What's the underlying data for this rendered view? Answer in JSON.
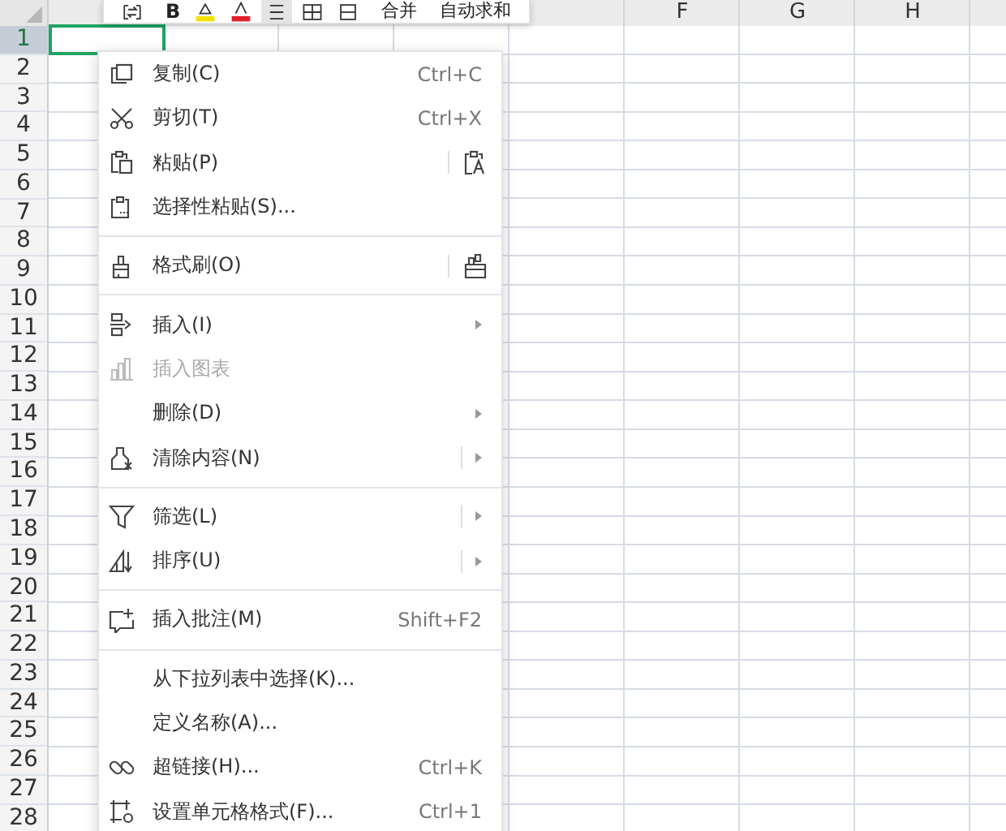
{
  "sheet": {
    "columns": [
      "F",
      "G",
      "H"
    ],
    "rows": [
      {
        "label": "1",
        "selected": true
      },
      {
        "label": "2",
        "selected": false
      },
      {
        "label": "3",
        "selected": false
      },
      {
        "label": "4",
        "selected": false
      },
      {
        "label": "5",
        "selected": false
      },
      {
        "label": "6",
        "selected": false
      },
      {
        "label": "7",
        "selected": false
      },
      {
        "label": "8",
        "selected": false
      },
      {
        "label": "9",
        "selected": false
      },
      {
        "label": "10",
        "selected": false
      },
      {
        "label": "11",
        "selected": false
      },
      {
        "label": "12",
        "selected": false
      },
      {
        "label": "13",
        "selected": false
      },
      {
        "label": "14",
        "selected": false
      },
      {
        "label": "15",
        "selected": false
      },
      {
        "label": "16",
        "selected": false
      },
      {
        "label": "17",
        "selected": false
      },
      {
        "label": "18",
        "selected": false
      },
      {
        "label": "19",
        "selected": false
      },
      {
        "label": "20",
        "selected": false
      },
      {
        "label": "21",
        "selected": false
      },
      {
        "label": "22",
        "selected": false
      },
      {
        "label": "23",
        "selected": false
      },
      {
        "label": "24",
        "selected": false
      },
      {
        "label": "25",
        "selected": false
      },
      {
        "label": "26",
        "selected": false
      },
      {
        "label": "27",
        "selected": false
      },
      {
        "label": "28",
        "selected": false
      }
    ]
  },
  "toolbar": {
    "items": [
      {
        "kind": "icon"
      },
      {
        "kind": "text",
        "label": "B"
      },
      {
        "kind": "icon"
      },
      {
        "kind": "icon"
      },
      {
        "kind": "icon"
      },
      {
        "kind": "icon"
      },
      {
        "kind": "icon"
      },
      {
        "kind": "text",
        "label": "合并"
      },
      {
        "kind": "text",
        "label": "自动求和"
      }
    ]
  },
  "menu": {
    "groups": [
      [
        {
          "label": "复制(C)",
          "shortcut": "Ctrl+C",
          "disabled": false,
          "submenu": false,
          "split": false
        },
        {
          "label": "剪切(T)",
          "shortcut": "Ctrl+X",
          "disabled": false,
          "submenu": false,
          "split": false
        },
        {
          "label": "粘贴(P)",
          "disabled": false,
          "submenu": false,
          "split": true
        },
        {
          "label": "选择性粘贴(S)...",
          "disabled": false,
          "submenu": false,
          "split": false
        }
      ],
      [
        {
          "label": "格式刷(O)",
          "disabled": false,
          "submenu": false,
          "split": true
        }
      ],
      [
        {
          "label": "插入(I)",
          "disabled": false,
          "submenu": true,
          "split": false
        },
        {
          "label": "插入图表",
          "disabled": true,
          "submenu": false,
          "split": false
        },
        {
          "label": "删除(D)",
          "disabled": false,
          "submenu": true,
          "split": false
        },
        {
          "label": "清除内容(N)",
          "disabled": false,
          "submenu": true,
          "split": true
        }
      ],
      [
        {
          "label": "筛选(L)",
          "disabled": false,
          "submenu": true,
          "split": true
        },
        {
          "label": "排序(U)",
          "disabled": false,
          "submenu": true,
          "split": true
        }
      ],
      [
        {
          "label": "插入批注(M)",
          "shortcut": "Shift+F2",
          "disabled": false,
          "submenu": false,
          "split": false
        }
      ],
      [
        {
          "label": "从下拉列表中选择(K)...",
          "disabled": false,
          "submenu": false,
          "split": false
        },
        {
          "label": "定义名称(A)...",
          "disabled": false,
          "submenu": false,
          "split": false
        },
        {
          "label": "超链接(H)...",
          "shortcut": "Ctrl+K",
          "disabled": false,
          "submenu": false,
          "split": false
        },
        {
          "label": "设置单元格格式(F)...",
          "shortcut": "Ctrl+1",
          "disabled": false,
          "submenu": false,
          "split": false
        }
      ]
    ]
  }
}
